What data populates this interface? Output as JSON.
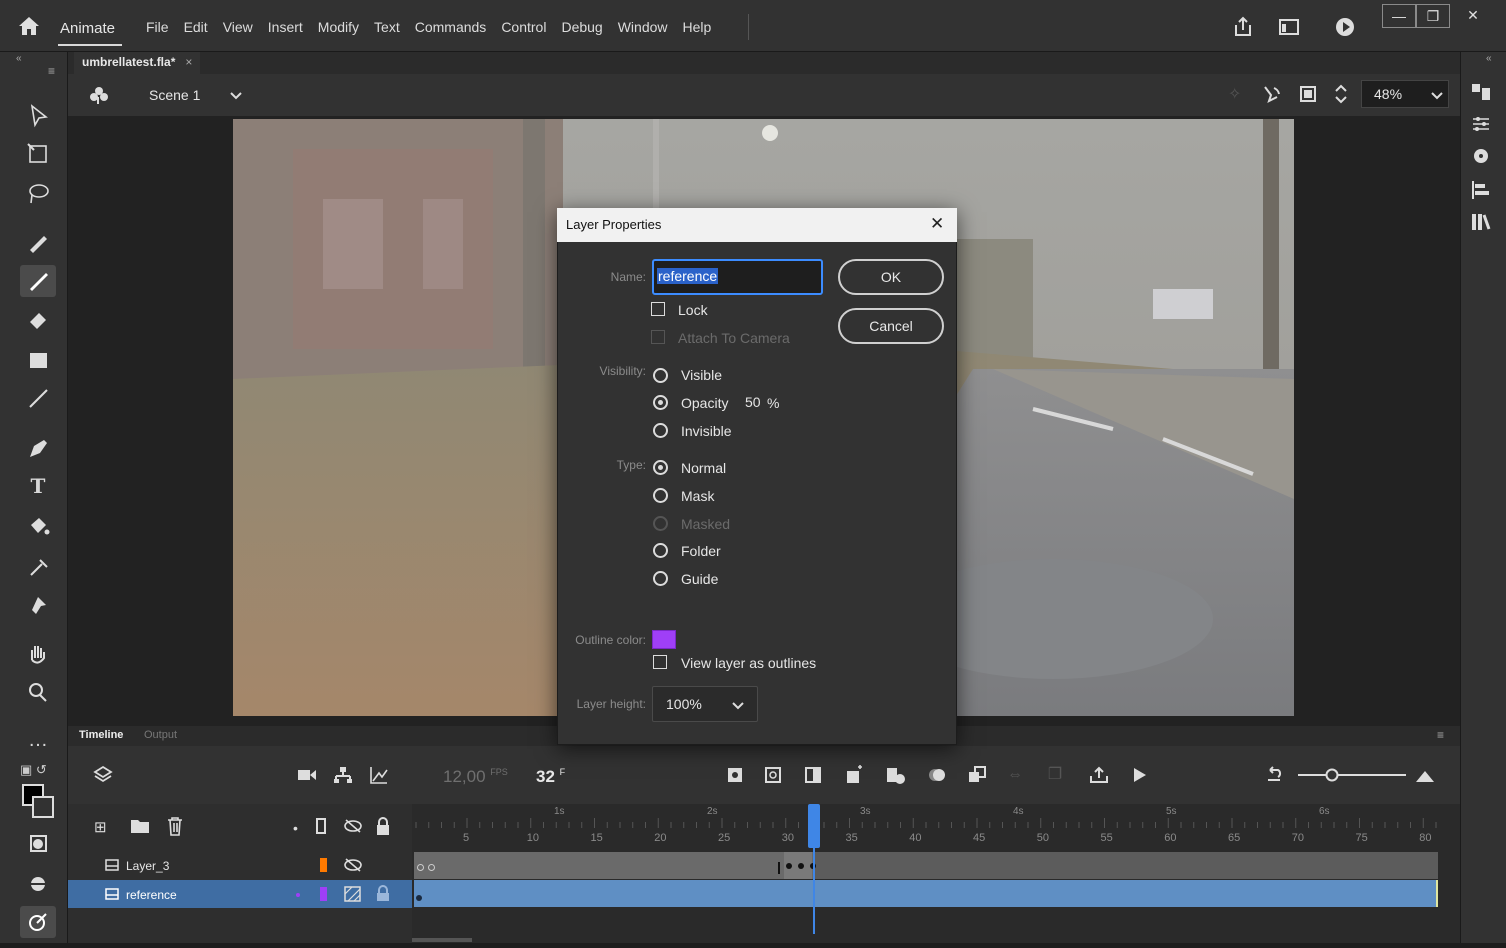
{
  "app": {
    "name": "Animate"
  },
  "menu": [
    "File",
    "Edit",
    "View",
    "Insert",
    "Modify",
    "Text",
    "Commands",
    "Control",
    "Debug",
    "Window",
    "Help"
  ],
  "document": {
    "tab": "umbrellatest.fla*",
    "tab_close": "×"
  },
  "scene": {
    "label": "Scene 1",
    "zoom": "48%"
  },
  "timeline": {
    "tabs": [
      "Timeline",
      "Output"
    ],
    "fps": "12,00",
    "fps_unit": "FPS",
    "frame": "32",
    "frame_unit": "F",
    "seconds": [
      "1s",
      "2s",
      "3s",
      "4s",
      "5s",
      "6s"
    ],
    "frame_ticks": [
      "5",
      "10",
      "15",
      "20",
      "25",
      "30",
      "35",
      "40",
      "45",
      "50",
      "55",
      "60",
      "65",
      "70",
      "75",
      "80"
    ],
    "layers": [
      {
        "name": "Layer_3",
        "color": "#ff7a00"
      },
      {
        "name": "reference",
        "color": "#9f3ff7",
        "selected": true
      }
    ]
  },
  "dialog": {
    "title": "Layer Properties",
    "name_label": "Name:",
    "name_value": "reference",
    "lock_label": "Lock",
    "attach_label": "Attach To Camera",
    "ok_label": "OK",
    "cancel_label": "Cancel",
    "visibility_label": "Visibility:",
    "visibility_options": [
      "Visible",
      "Opacity",
      "Invisible"
    ],
    "visibility_selected": "Opacity",
    "opacity_value": "50",
    "opacity_unit": "%",
    "type_label": "Type:",
    "type_options": [
      "Normal",
      "Mask",
      "Masked",
      "Folder",
      "Guide"
    ],
    "type_selected": "Normal",
    "outline_color_label": "Outline color:",
    "outline_color": "#9f3ff7",
    "outlines_label": "View layer as outlines",
    "layer_height_label": "Layer height:",
    "layer_height_value": "100%"
  },
  "icons": {
    "accent": "#3f86e6"
  }
}
